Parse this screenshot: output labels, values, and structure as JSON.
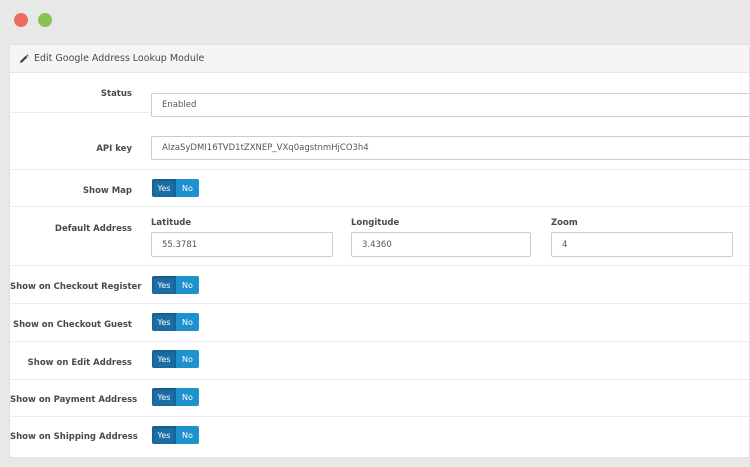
{
  "window": {
    "controls": [
      "close",
      "maximize"
    ]
  },
  "panel": {
    "title": "Edit Google Address Lookup Module",
    "icon": "pencil-icon"
  },
  "form": {
    "status": {
      "label": "Status",
      "value": "Enabled"
    },
    "api_key": {
      "label": "API key",
      "value": "AIzaSyDMI16TVD1tZXNEP_VXq0agstnmHjCO3h4"
    },
    "show_map": {
      "label": "Show Map",
      "yes": "Yes",
      "no": "No",
      "selected": "Yes"
    },
    "default_address": {
      "label": "Default Address",
      "latitude": {
        "label": "Latitude",
        "value": "55.3781"
      },
      "longitude": {
        "label": "Longitude",
        "value": "3.4360"
      },
      "zoom": {
        "label": "Zoom",
        "value": "4"
      }
    },
    "toggles": [
      {
        "label": "Show on Checkout Register",
        "yes": "Yes",
        "no": "No",
        "selected": "Yes"
      },
      {
        "label": "Show on Checkout Guest",
        "yes": "Yes",
        "no": "No",
        "selected": "Yes"
      },
      {
        "label": "Show on Edit Address",
        "yes": "Yes",
        "no": "No",
        "selected": "Yes"
      },
      {
        "label": "Show on Payment Address",
        "yes": "Yes",
        "no": "No",
        "selected": "Yes"
      },
      {
        "label": "Show on Shipping Address",
        "yes": "Yes",
        "no": "No",
        "selected": "Yes"
      }
    ]
  },
  "colors": {
    "toggle_active": "#1a6ea3",
    "toggle_inactive": "#1e91cf",
    "close": "#ee6b60",
    "maximize": "#8cc152"
  }
}
